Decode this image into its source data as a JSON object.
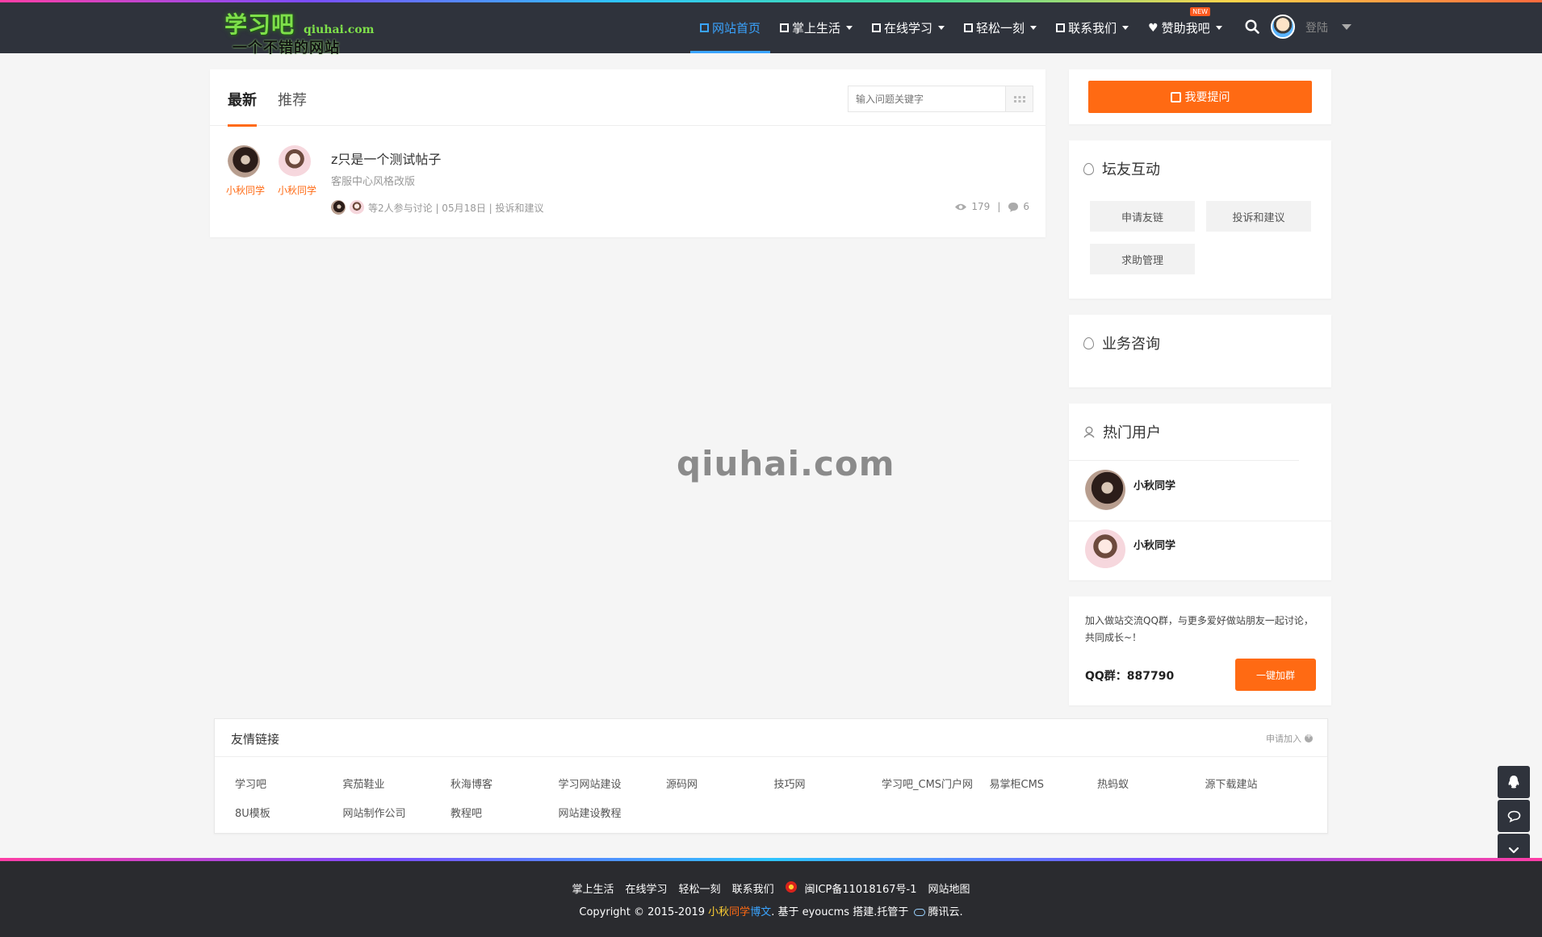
{
  "header": {
    "logo": {
      "main": "学习吧",
      "domain": "qiuhai.com",
      "slogan": "一个不错的网站"
    },
    "nav": [
      {
        "label": "网站首页",
        "active": true,
        "dropdown": false
      },
      {
        "label": "掌上生活",
        "active": false,
        "dropdown": true
      },
      {
        "label": "在线学习",
        "active": false,
        "dropdown": true
      },
      {
        "label": "轻松一刻",
        "active": false,
        "dropdown": true
      },
      {
        "label": "联系我们",
        "active": false,
        "dropdown": true
      },
      {
        "label": "赞助我吧",
        "active": false,
        "dropdown": true,
        "badge": "NEW"
      }
    ],
    "login_label": "登陆",
    "accent_color": "#3aa4ff",
    "icons": [
      "search-icon",
      "avatar",
      "chevron-down-icon"
    ]
  },
  "main": {
    "tabs": [
      "最新",
      "推荐"
    ],
    "search_placeholder": "输入问题关键字",
    "posts": [
      {
        "authors": [
          "小秋同学",
          "小秋同学"
        ],
        "title": "z只是一个测试帖子",
        "excerpt": "客服中心风格改版",
        "meta": "等2人参与讨论 | 05月18日 | 投诉和建议",
        "views": "179",
        "comments": "6"
      }
    ]
  },
  "sidebar": {
    "ask_button": "我要提问",
    "forum": {
      "title": "坛友互动",
      "chips": [
        "申请友链",
        "投诉和建议",
        "求助管理"
      ]
    },
    "business": {
      "title": "业务咨询"
    },
    "hot_users": {
      "title": "热门用户",
      "users": [
        "小秋同学",
        "小秋同学"
      ]
    },
    "qq": {
      "text": "加入做站交流QQ群，与更多爱好做站朋友一起讨论，共同成长~！",
      "group_label": "QQ群：887790",
      "join_button": "一键加群"
    },
    "brand_color": "#ff6a13"
  },
  "watermark": "qiuhai.com",
  "friend_links": {
    "title": "友情链接",
    "apply": "申请加入",
    "links": [
      "学习吧",
      "宾茄鞋业",
      "秋海博客",
      "学习网站建设",
      "源码网",
      "技巧网",
      "学习吧_CMS门户网",
      "易掌柜CMS",
      "热蚂蚁",
      "源下载建站",
      "8U模板",
      "网站制作公司",
      "教程吧",
      "网站建设教程"
    ]
  },
  "footer": {
    "nav": [
      "掌上生活",
      "在线学习",
      "轻松一刻",
      "联系我们"
    ],
    "icp": "闽ICP备11018167号-1",
    "sitemap": "网站地图",
    "copyright_prefix": "Copyright © 2015-2019 ",
    "brand_a": "小秋",
    "brand_b": "同学",
    "brand_c": "博文",
    "copyright_suffix": ". 基于 eyoucms 搭建.托管于 ",
    "host": "腾讯云."
  }
}
